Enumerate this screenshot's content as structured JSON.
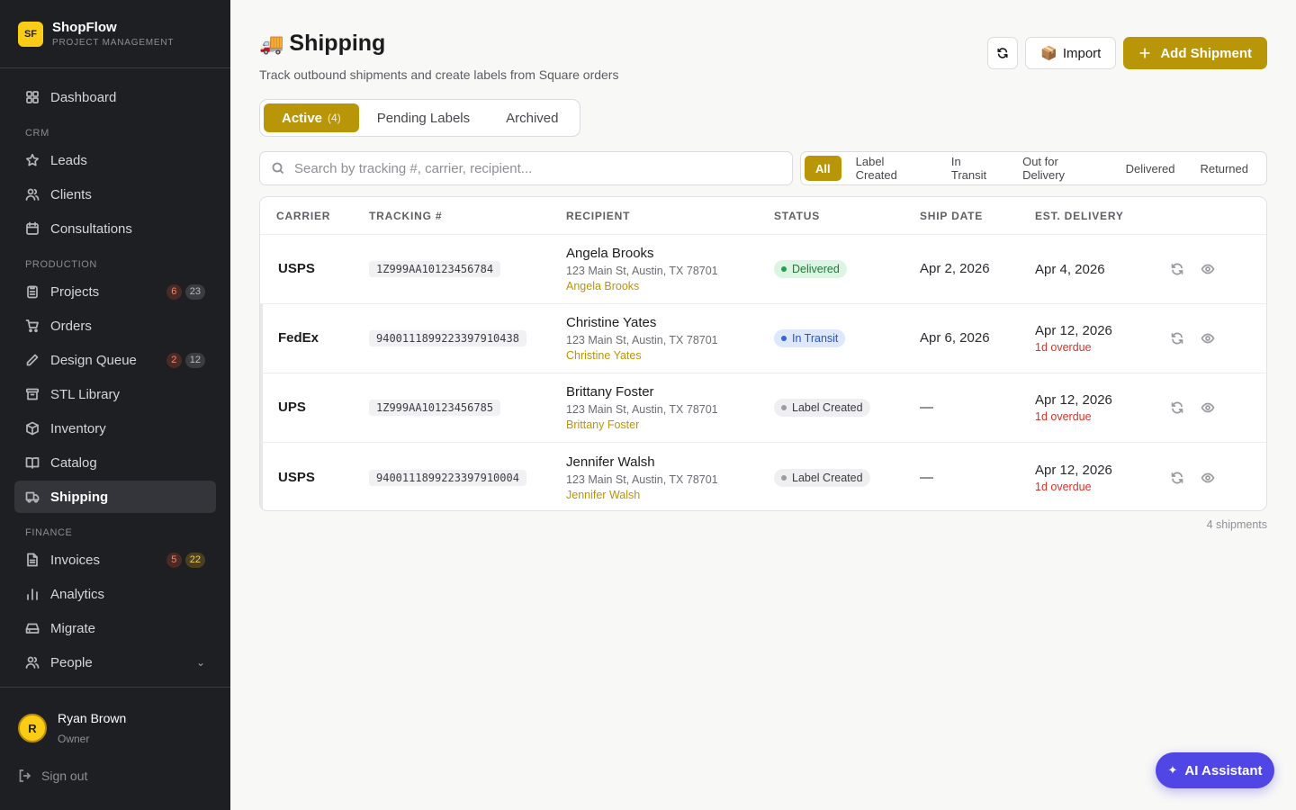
{
  "brand": {
    "logo": "SF",
    "name": "ShopFlow",
    "subtitle": "PROJECT MANAGEMENT"
  },
  "sidebar": {
    "dashboard": "Dashboard",
    "section_crm": "CRM",
    "leads": "Leads",
    "clients": "Clients",
    "consultations": "Consultations",
    "section_production": "PRODUCTION",
    "projects": {
      "label": "Projects",
      "badge_alert": "6",
      "badge_total": "23"
    },
    "orders": "Orders",
    "design_queue": {
      "label": "Design Queue",
      "badge_alert": "2",
      "badge_total": "12"
    },
    "stl_library": "STL Library",
    "inventory": "Inventory",
    "catalog": "Catalog",
    "shipping": "Shipping",
    "section_finance": "FINANCE",
    "invoices": {
      "label": "Invoices",
      "badge_alert": "5",
      "badge_total": "22"
    },
    "analytics": "Analytics",
    "migrate": "Migrate",
    "people": "People"
  },
  "user": {
    "initial": "R",
    "name": "Ryan Brown",
    "role": "Owner",
    "signout": "Sign out"
  },
  "page": {
    "emoji": "🚚",
    "title": "Shipping",
    "subtitle": "Track outbound shipments and create labels from Square orders",
    "import_emoji": "📦",
    "import_label": "Import",
    "add_label": "Add Shipment"
  },
  "tabs": {
    "active": "Active",
    "active_count": "(4)",
    "pending": "Pending Labels",
    "archived": "Archived"
  },
  "search": {
    "placeholder": "Search by tracking #, carrier, recipient..."
  },
  "filters": {
    "all": "All",
    "label_created": "Label Created",
    "in_transit": "In Transit",
    "out_for_delivery": "Out for Delivery",
    "delivered": "Delivered",
    "returned": "Returned"
  },
  "table": {
    "headers": {
      "carrier": "CARRIER",
      "tracking": "TRACKING #",
      "recipient": "RECIPIENT",
      "status": "STATUS",
      "ship_date": "SHIP DATE",
      "est_delivery": "EST. DELIVERY"
    },
    "rows": [
      {
        "carrier": "USPS",
        "tracking": "1Z999AA10123456784",
        "name": "Angela Brooks",
        "address": "123 Main St, Austin, TX 78701",
        "link": "Angela Brooks",
        "status": "Delivered",
        "ship_date": "Apr 2, 2026",
        "est": "Apr 4, 2026",
        "overdue": ""
      },
      {
        "carrier": "FedEx",
        "tracking": "9400111899223397910438",
        "name": "Christine Yates",
        "address": "123 Main St, Austin, TX 78701",
        "link": "Christine Yates",
        "status": "In Transit",
        "ship_date": "Apr 6, 2026",
        "est": "Apr 12, 2026",
        "overdue": "1d overdue"
      },
      {
        "carrier": "UPS",
        "tracking": "1Z999AA10123456785",
        "name": "Brittany Foster",
        "address": "123 Main St, Austin, TX 78701",
        "link": "Brittany Foster",
        "status": "Label Created",
        "ship_date": "—",
        "est": "Apr 12, 2026",
        "overdue": "1d overdue"
      },
      {
        "carrier": "USPS",
        "tracking": "9400111899223397910004",
        "name": "Jennifer Walsh",
        "address": "123 Main St, Austin, TX 78701",
        "link": "Jennifer Walsh",
        "status": "Label Created",
        "ship_date": "—",
        "est": "Apr 12, 2026",
        "overdue": "1d overdue"
      }
    ]
  },
  "footer": {
    "count": "4 shipments"
  },
  "ai": {
    "icon": "✦",
    "label": "AI Assistant"
  },
  "colors": {
    "accent": "#b99508",
    "sidebar_bg": "#1e1f22",
    "ai": "#4f46e5",
    "overdue": "#d2362b"
  }
}
